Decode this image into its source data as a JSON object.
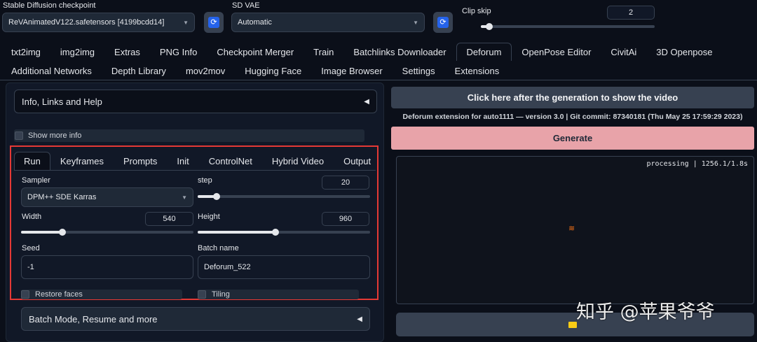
{
  "top": {
    "checkpoint_label": "Stable Diffusion checkpoint",
    "checkpoint_value": "ReVAnimatedV122.safetensors [4199bcdd14]",
    "vae_label": "SD VAE",
    "vae_value": "Automatic",
    "clip_skip_label": "Clip skip",
    "clip_skip_value": "2",
    "clip_skip_fraction": 0.05
  },
  "main_tabs_row1": [
    "txt2img",
    "img2img",
    "Extras",
    "PNG Info",
    "Checkpoint Merger",
    "Train",
    "Batchlinks Downloader",
    "Deforum",
    "OpenPose Editor",
    "CivitAi",
    "3D Openpose"
  ],
  "main_tabs_row2": [
    "Additional Networks",
    "Depth Library",
    "mov2mov",
    "Hugging Face",
    "Image Browser",
    "Settings",
    "Extensions"
  ],
  "active_tab": "Deforum",
  "left": {
    "info_accordion": "Info, Links and Help",
    "show_more_info": "Show more info",
    "sub_tabs": [
      "Run",
      "Keyframes",
      "Prompts",
      "Init",
      "ControlNet",
      "Hybrid Video",
      "Output"
    ],
    "active_sub_tab": "Run",
    "sampler_label": "Sampler",
    "sampler_value": "DPM++ SDE Karras",
    "step_label": "step",
    "step_value": "20",
    "step_fraction": 0.11,
    "width_label": "Width",
    "width_value": "540",
    "width_fraction": 0.24,
    "height_label": "Height",
    "height_value": "960",
    "height_fraction": 0.45,
    "seed_label": "Seed",
    "seed_value": "-1",
    "batch_name_label": "Batch name",
    "batch_name_value": "Deforum_522",
    "restore_faces": "Restore faces",
    "tiling": "Tiling",
    "batch_accordion": "Batch Mode, Resume and more"
  },
  "right": {
    "video_button": "Click here after the generation to show the video",
    "version_text": "Deforum extension for auto1111 — version 3.0 | Git commit: 87340181 (Thu May 25 17:59:29 2023)",
    "generate_button": "Generate",
    "progress_text": "processing | 1256.1/1.8s"
  },
  "watermark": "知乎 @苹果爷爷",
  "colors": {
    "background": "#0b0f19",
    "generate": "#e8a3a9",
    "highlight_box": "#e53935",
    "refresh_icon": "#2563eb"
  }
}
